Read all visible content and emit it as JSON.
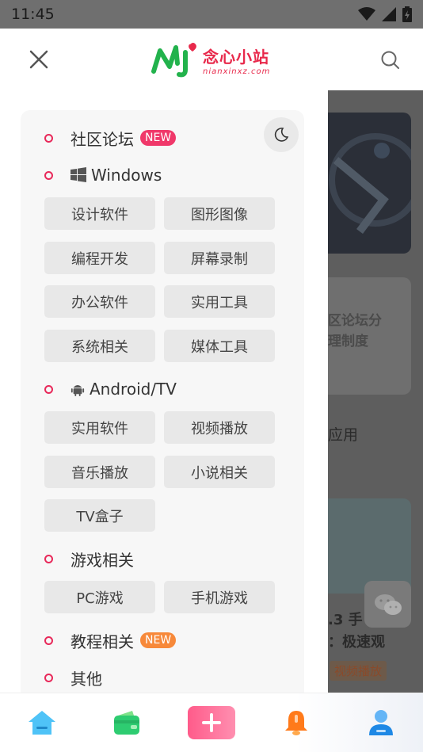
{
  "status": {
    "time": "11:45"
  },
  "brand": {
    "name": "念心小站",
    "url": "nianxinxz.com"
  },
  "background": {
    "card2_line1": "区论坛分",
    "card2_line2": "理制度",
    "section_title": "应用",
    "post_title_line1": ".3 手",
    "post_title_line2": "：极速观",
    "post_tag": "视频播放"
  },
  "menu": {
    "community": {
      "label": "社区论坛",
      "badge": "NEW"
    },
    "windows": {
      "label": "Windows",
      "items": [
        "设计软件",
        "图形图像",
        "编程开发",
        "屏幕录制",
        "办公软件",
        "实用工具",
        "系统相关",
        "媒体工具"
      ]
    },
    "android": {
      "label": "Android/TV",
      "items": [
        "实用软件",
        "视频播放",
        "音乐播放",
        "小说相关",
        "TV盒子"
      ]
    },
    "games": {
      "label": "游戏相关",
      "items": [
        "PC游戏",
        "手机游戏"
      ]
    },
    "tutorials": {
      "label": "教程相关",
      "badge": "NEW"
    },
    "other": {
      "label": "其他"
    }
  },
  "colors": {
    "accent": "#e8295a",
    "badge_pink": "#f0386a",
    "badge_orange": "#f7893a"
  }
}
